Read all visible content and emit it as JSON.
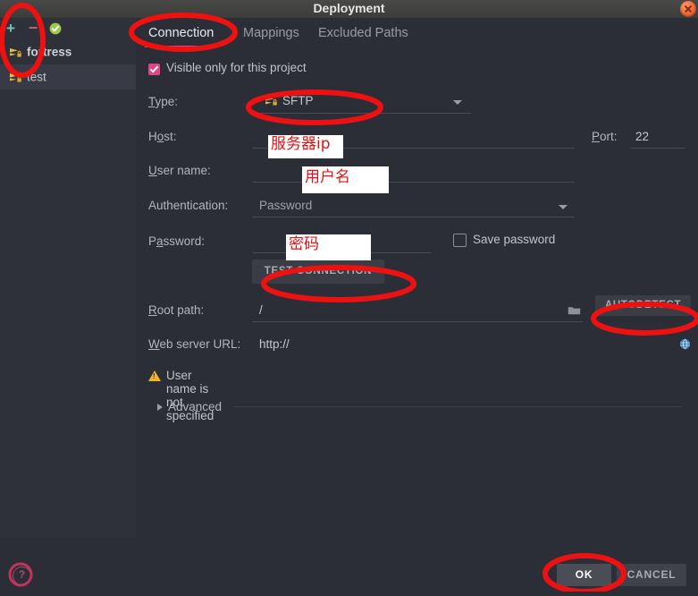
{
  "window": {
    "title": "Deployment",
    "close_icon": "close-icon"
  },
  "sidebar": {
    "toolbar": [
      {
        "name": "add-server-button",
        "glyph": "+"
      },
      {
        "name": "remove-server-button",
        "glyph": "−"
      },
      {
        "name": "set-default-server-button",
        "glyph": "check-badge-icon"
      }
    ],
    "servers": [
      {
        "label": "fortress",
        "icon": "sftp-icon",
        "selected": false,
        "default": true
      },
      {
        "label": "test",
        "icon": "sftp-icon",
        "selected": true,
        "default": false
      }
    ]
  },
  "tabs": [
    {
      "label": "Connection",
      "active": true
    },
    {
      "label": "Mappings",
      "active": false
    },
    {
      "label": "Excluded Paths",
      "active": false
    }
  ],
  "form": {
    "visible_only_label": "Visible only for this project",
    "visible_only_checked": true,
    "type_label": "Type:",
    "type_value": "SFTP",
    "type_icon": "sftp-icon",
    "host_label": "Host:",
    "host_value": "",
    "port_label": "Port:",
    "port_value": "22",
    "username_label": "User name:",
    "username_value": "",
    "auth_label": "Authentication:",
    "auth_value": "Password",
    "password_label": "Password:",
    "password_value": "",
    "save_password_label": "Save password",
    "save_password_checked": false,
    "test_connection_label": "TEST CONNECTION",
    "root_path_label": "Root path:",
    "root_path_value": "/",
    "browse_icon": "folder-icon",
    "autodetect_label": "AUTODETECT",
    "web_url_label": "Web server URL:",
    "web_url_value": "http://",
    "open_browser_icon": "globe-icon",
    "warning_icon": "warning-triangle-icon",
    "warning_text": "User name is not specified",
    "advanced_label": "Advanced"
  },
  "footer": {
    "help_icon": "help-question-icon",
    "ok_label": "OK",
    "cancel_label": "CANCEL"
  },
  "annotations": {
    "accent_red": "#ee1111",
    "redactions": [
      {
        "name": "host-redaction",
        "text": "服务器ip"
      },
      {
        "name": "username-redaction",
        "text": "用户名"
      },
      {
        "name": "password-redaction",
        "text": "密码"
      }
    ],
    "circles": [
      "add-server-circle",
      "connection-tab-circle",
      "sftp-type-circle",
      "test-connection-circle",
      "autodetect-circle",
      "ok-button-circle",
      "help-icon-circle"
    ]
  },
  "colors": {
    "window_bg": "#2b2e37",
    "sidebar_bg": "#2e313a",
    "accent_pink": "#e2457f",
    "warning_yellow": "#f0b429",
    "annotation_red": "#ee1111"
  }
}
